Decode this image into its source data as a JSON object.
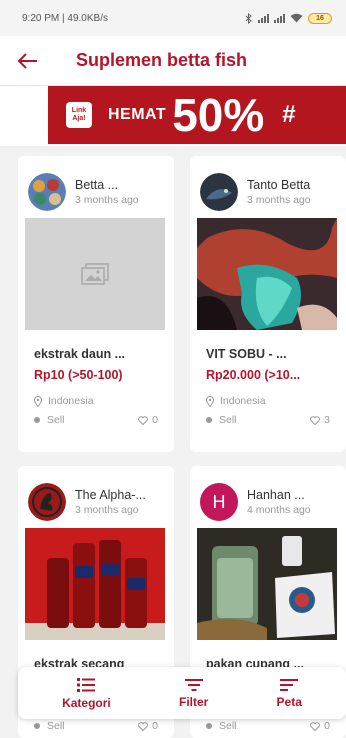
{
  "status": {
    "time_speed": "9:20 PM | 49.0KB/s",
    "battery": "16"
  },
  "header": {
    "title": "Suplemen betta fish"
  },
  "banner": {
    "logo_top": "Link",
    "logo_bottom": "Aja!",
    "hemat": "HEMAT",
    "percent": "50%",
    "hash": "#"
  },
  "colors": {
    "accent": "#b5152b",
    "banner_bg": "#b3161f",
    "avatar_hanhan": "#c2185b"
  },
  "cards": [
    {
      "seller": "Betta ...",
      "time": "3 months ago",
      "title": "ekstrak daun ...",
      "price": "Rp10  (>50-100)",
      "location": "Indonesia",
      "type": "Sell",
      "likes": "0"
    },
    {
      "seller": "Tanto Betta",
      "time": "3 months ago",
      "title": "VIT SOBU - ...",
      "price": "Rp20.000  (>10...",
      "location": "Indonesia",
      "type": "Sell",
      "likes": "3"
    },
    {
      "seller": "The Alpha-...",
      "time": "3 months ago",
      "title": "ekstrak secang",
      "type": "Sell",
      "likes": "0"
    },
    {
      "seller": "Hanhan ...",
      "avatar_letter": "H",
      "time": "4 months ago",
      "title": "pakan cupang ...",
      "type": "Sell",
      "likes": "0"
    }
  ],
  "bottom_bar": {
    "kategori": "Kategori",
    "filter": "Filter",
    "peta": "Peta"
  }
}
